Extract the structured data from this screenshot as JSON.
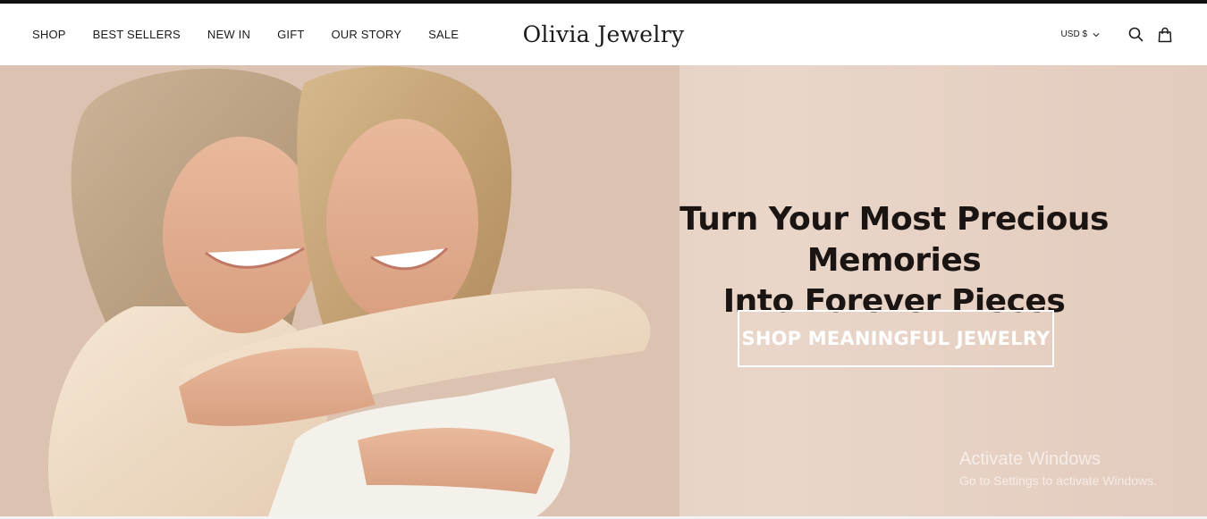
{
  "header": {
    "nav": [
      "SHOP",
      "BEST SELLERS",
      "NEW IN",
      "GIFT",
      "OUR STORY",
      "SALE"
    ],
    "logo": "Olivia Jewelry",
    "currency": "USD $",
    "icons": [
      "chevron-down-icon",
      "search-icon",
      "cart-bag-icon"
    ]
  },
  "hero": {
    "title_line1": "Turn Your Most Precious Memories",
    "title_line2": "Into Forever Pieces",
    "cta": "SHOP MEANINGFUL JEWELRY",
    "photo": "mother and daughter hugging",
    "colors": {
      "background": "#e6d1c3",
      "title": "#1a1412",
      "cta_border": "#ffffff"
    }
  },
  "os_watermark": {
    "line1": "Activate Windows",
    "line2": "Go to Settings to activate Windows."
  }
}
